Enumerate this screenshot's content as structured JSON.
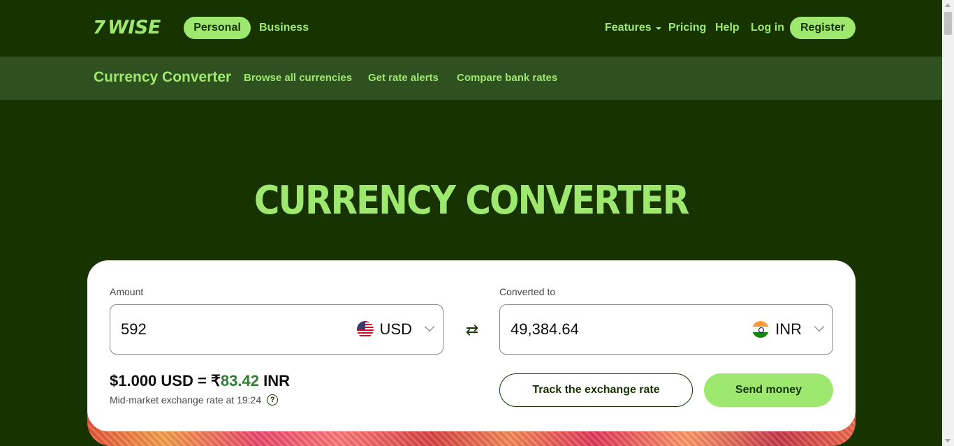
{
  "brand": {
    "mark": "7",
    "name": "WISE"
  },
  "topnav": {
    "personal": "Personal",
    "business": "Business",
    "features": "Features",
    "pricing": "Pricing",
    "help": "Help",
    "login": "Log in",
    "register": "Register"
  },
  "subnav": {
    "title": "Currency Converter",
    "links": [
      "Browse all currencies",
      "Get rate alerts",
      "Compare bank rates"
    ]
  },
  "hero": {
    "title": "CURRENCY CONVERTER"
  },
  "converter": {
    "amount_label": "Amount",
    "amount_value": "592",
    "from_currency": "USD",
    "converted_label": "Converted to",
    "converted_value": "49,384.64",
    "to_currency": "INR",
    "swap_icon": "⇄",
    "rate_prefix": "$1.000 USD = ₹",
    "rate_value": "83.42",
    "rate_suffix": " INR",
    "mid_market": "Mid-market exchange rate at 19:24",
    "help_glyph": "?",
    "track_button": "Track the exchange rate",
    "send_button": "Send money"
  },
  "colors": {
    "brand_green": "#9fe870",
    "forest": "#163300",
    "rate_green": "#2f7d32"
  }
}
